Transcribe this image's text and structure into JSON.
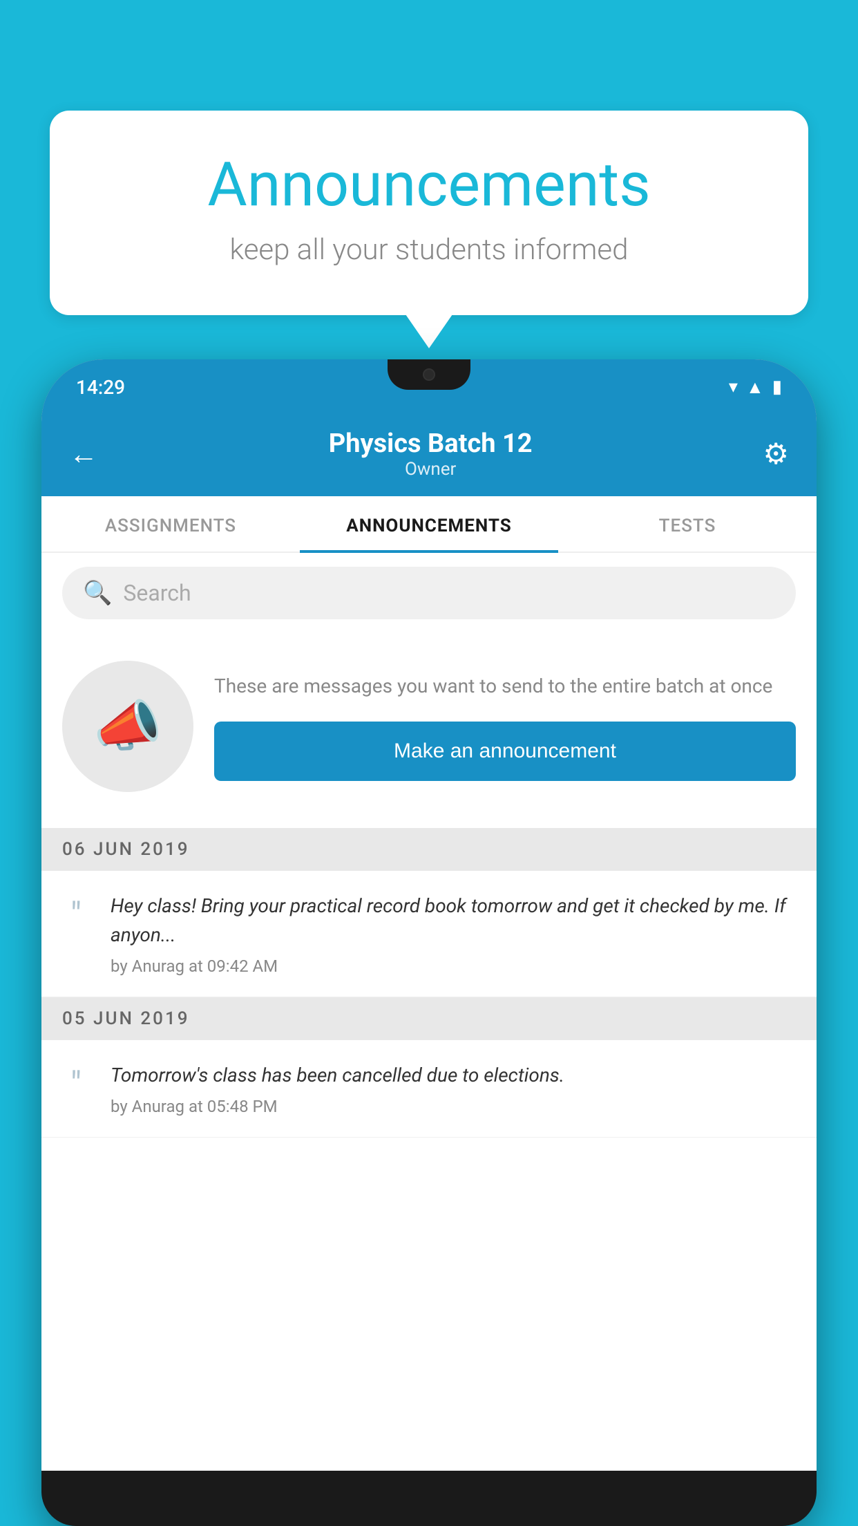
{
  "background_color": "#1ab8d8",
  "speech_bubble": {
    "title": "Announcements",
    "subtitle": "keep all your students informed"
  },
  "phone": {
    "status_bar": {
      "time": "14:29",
      "wifi_icon": "▾",
      "signal_icon": "▲",
      "battery_icon": "▮"
    },
    "header": {
      "title": "Physics Batch 12",
      "subtitle": "Owner",
      "back_label": "←",
      "gear_label": "⚙"
    },
    "tabs": [
      {
        "label": "ASSIGNMENTS",
        "active": false
      },
      {
        "label": "ANNOUNCEMENTS",
        "active": true
      },
      {
        "label": "TESTS",
        "active": false
      }
    ],
    "search": {
      "placeholder": "Search"
    },
    "announcement_prompt": {
      "description": "These are messages you want to send to the entire batch at once",
      "button_label": "Make an announcement"
    },
    "announcements": [
      {
        "date": "06  JUN  2019",
        "message": "Hey class! Bring your practical record book tomorrow and get it checked by me. If anyon...",
        "author": "by Anurag at 09:42 AM"
      },
      {
        "date": "05  JUN  2019",
        "message": "Tomorrow's class has been cancelled due to elections.",
        "author": "by Anurag at 05:48 PM"
      }
    ]
  }
}
